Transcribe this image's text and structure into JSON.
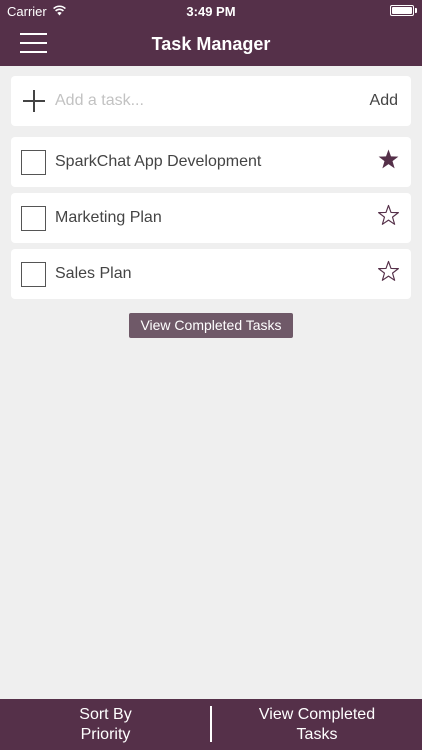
{
  "status_bar": {
    "carrier": "Carrier",
    "time": "3:49 PM",
    "wifi_icon": "wifi-icon",
    "battery_icon": "battery-icon",
    "battery_level": 1.0
  },
  "nav": {
    "title": "Task Manager",
    "menu_icon": "hamburger-menu-icon"
  },
  "add_task": {
    "icon": "plus-icon",
    "placeholder": "Add a task...",
    "value": "",
    "button_label": "Add"
  },
  "tasks": [
    {
      "title": "SparkChat App Development",
      "completed": false,
      "starred": true
    },
    {
      "title": "Marketing Plan",
      "completed": false,
      "starred": false
    },
    {
      "title": "Sales Plan",
      "completed": false,
      "starred": false
    }
  ],
  "view_completed_label": "View Completed Tasks",
  "toolbar": {
    "sort_label_line1": "Sort By",
    "sort_label_line2": "Priority",
    "view_completed_line1": "View Completed",
    "view_completed_line2": "Tasks"
  },
  "colors": {
    "accent": "#553049",
    "button": "#6f5968",
    "background": "#efefef",
    "star_filled": "#553049"
  }
}
